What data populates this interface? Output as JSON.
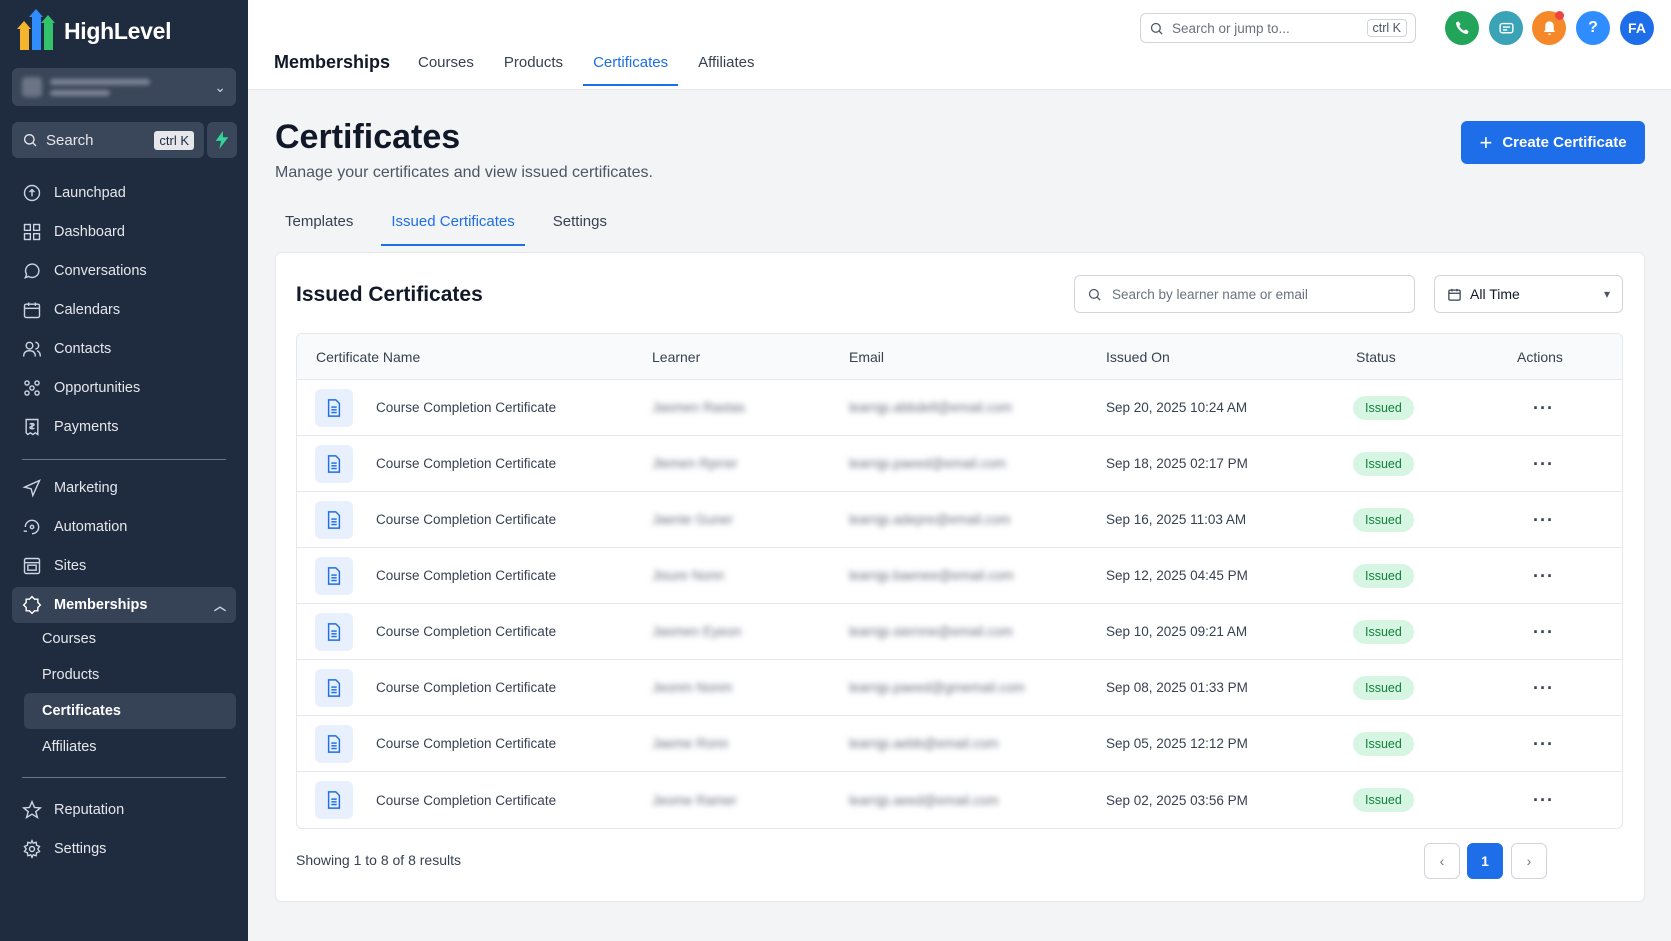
{
  "brand": {
    "name": "HighLevel"
  },
  "sidebar": {
    "search_label": "Search",
    "search_shortcut": "ctrl K",
    "items_top": [
      {
        "label": "Launchpad",
        "icon": "launchpad-icon"
      },
      {
        "label": "Dashboard",
        "icon": "dashboard-icon"
      },
      {
        "label": "Conversations",
        "icon": "conversations-icon"
      },
      {
        "label": "Calendars",
        "icon": "calendar-icon"
      },
      {
        "label": "Contacts",
        "icon": "contacts-icon"
      },
      {
        "label": "Opportunities",
        "icon": "opportunities-icon"
      },
      {
        "label": "Payments",
        "icon": "payments-icon"
      }
    ],
    "items_mid": [
      {
        "label": "Marketing",
        "icon": "marketing-icon"
      },
      {
        "label": "Automation",
        "icon": "automation-icon"
      },
      {
        "label": "Sites",
        "icon": "sites-icon"
      },
      {
        "label": "Memberships",
        "icon": "memberships-icon"
      }
    ],
    "sub_items": [
      "Courses",
      "Products",
      "Certificates",
      "Affiliates"
    ],
    "items_bottom": [
      {
        "label": "Reputation",
        "icon": "star-icon"
      },
      {
        "label": "Settings",
        "icon": "gear-icon"
      }
    ]
  },
  "topbar": {
    "title": "Memberships",
    "tabs": [
      "Courses",
      "Products",
      "Certificates",
      "Affiliates"
    ],
    "active_tab": "Certificates",
    "search_placeholder": "Search or jump to...",
    "search_shortcut": "ctrl K",
    "avatar_initials": "FA",
    "help_glyph": "?"
  },
  "page": {
    "title": "Certificates",
    "subtitle": "Manage your certificates and view issued certificates.",
    "create_button": "Create Certificate",
    "tabs": [
      "Templates",
      "Issued Certificates",
      "Settings"
    ],
    "active_tab": "Issued Certificates"
  },
  "issued": {
    "title": "Issued Certificates",
    "search_placeholder": "Search by learner name or email",
    "time_filter": "All Time",
    "columns": {
      "name": "Certificate Name",
      "learner": "Learner",
      "email": "Email",
      "issued_on": "Issued On",
      "status": "Status",
      "actions": "Actions"
    },
    "rows": [
      {
        "name": "Course Completion Certificate",
        "learner": "Jasmen Rastas",
        "email": "learnjp.abbdell@email.com",
        "issued_on": "Sep 20, 2025 10:24 AM",
        "status": "Issued"
      },
      {
        "name": "Course Completion Certificate",
        "learner": "Jlemen Rprrer",
        "email": "learnjp.paeed@email.com",
        "issued_on": "Sep 18, 2025 02:17 PM",
        "status": "Issued"
      },
      {
        "name": "Course Completion Certificate",
        "learner": "Jaenie Guner",
        "email": "learnjp.adepre@email.com",
        "issued_on": "Sep 16, 2025 11:03 AM",
        "status": "Issued"
      },
      {
        "name": "Course Completion Certificate",
        "learner": "Jisure Nonn",
        "email": "learnjp.baenee@email.com",
        "issued_on": "Sep 12, 2025 04:45 PM",
        "status": "Issued"
      },
      {
        "name": "Course Completion Certificate",
        "learner": "Jasmen Eyeon",
        "email": "learnjp.siernne@email.com",
        "issued_on": "Sep 10, 2025 09:21 AM",
        "status": "Issued"
      },
      {
        "name": "Course Completion Certificate",
        "learner": "Jeonm Nonm",
        "email": "learnjp.paeed@gmemail.com",
        "issued_on": "Sep 08, 2025 01:33 PM",
        "status": "Issued"
      },
      {
        "name": "Course Completion Certificate",
        "learner": "Jaeme Ronn",
        "email": "learnjp.aebb@email.com",
        "issued_on": "Sep 05, 2025 12:12 PM",
        "status": "Issued"
      },
      {
        "name": "Course Completion Certificate",
        "learner": "Jeome Ramer",
        "email": "learnjp.aeed@email.com",
        "issued_on": "Sep 02, 2025 03:56 PM",
        "status": "Issued"
      }
    ],
    "showing": "Showing 1 to 8 of 8 results",
    "current_page": "1"
  },
  "colors": {
    "accent": "#1d6ee8",
    "sidebar_bg": "#1f2b3e",
    "issued_bg": "#d6f5e3",
    "issued_text": "#15803d"
  }
}
